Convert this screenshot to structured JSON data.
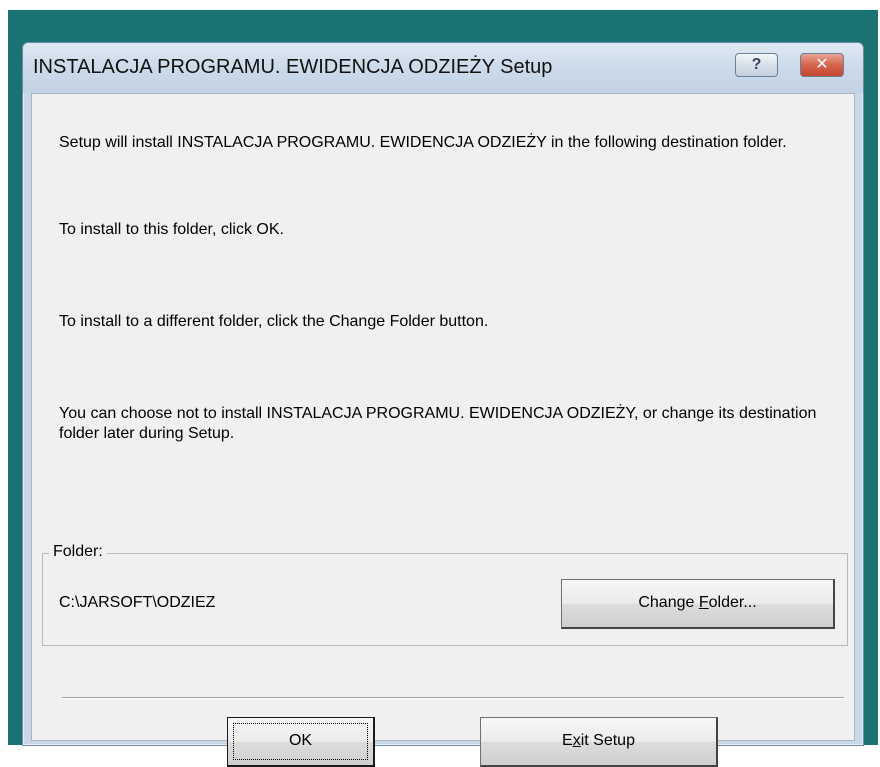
{
  "window": {
    "title": "INSTALACJA PROGRAMU. EWIDENCJA ODZIEŻY Setup",
    "help_glyph": "?",
    "close_glyph": "✕"
  },
  "messages": {
    "line1": "Setup will install INSTALACJA PROGRAMU. EWIDENCJA ODZIEŻY in the following destination folder.",
    "line2": "To install to this folder, click OK.",
    "line3": "To install to a different folder, click the Change Folder button.",
    "line4": "You can choose not to install INSTALACJA PROGRAMU. EWIDENCJA ODZIEŻY, or change its destination folder later during Setup."
  },
  "folder_group": {
    "label": "Folder:",
    "path": "C:\\JARSOFT\\ODZIEZ",
    "change_button": {
      "pre": "Change ",
      "hotkey": "F",
      "post": "older..."
    }
  },
  "buttons": {
    "ok_label": "OK",
    "exit": {
      "pre": "E",
      "hotkey": "x",
      "post": "it Setup"
    }
  },
  "colors": {
    "desktop": "#1b7272",
    "window_frame": "#c9d8e6",
    "client_bg": "#f0f0f0",
    "close_button": "#c54632"
  }
}
